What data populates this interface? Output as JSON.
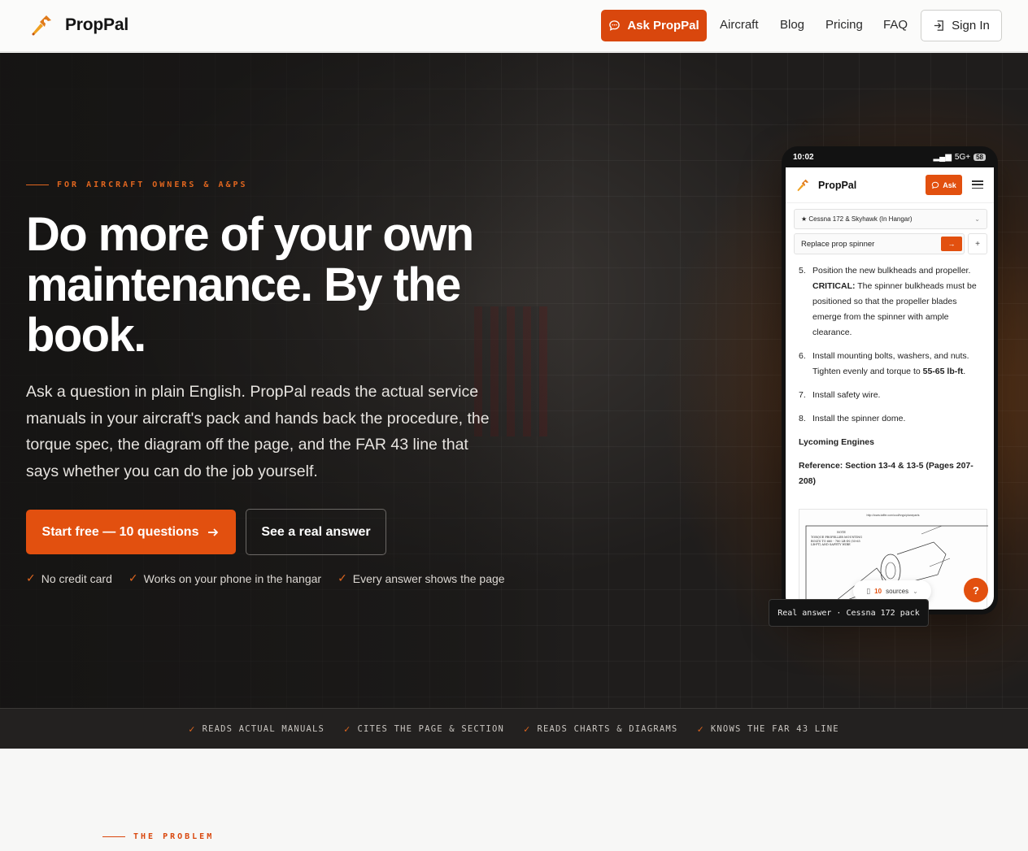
{
  "nav": {
    "brand": "PropPal",
    "ask_label": "Ask PropPal",
    "links": [
      "Aircraft",
      "Blog",
      "Pricing",
      "FAQ"
    ],
    "signin_label": "Sign In"
  },
  "hero": {
    "eyebrow": "FOR AIRCRAFT OWNERS & A&PS",
    "title": "Do more of your own maintenance. By the book.",
    "subtitle": "Ask a question in plain English. PropPal reads the actual service manuals in your aircraft's pack and hands back the procedure, the torque spec, the diagram off the page, and the FAR 43 line that says whether you can do the job yourself.",
    "cta_primary": "Start free — 10 questions",
    "cta_secondary": "See a real answer",
    "checks": [
      "No credit card",
      "Works on your phone in the hangar",
      "Every answer shows the page"
    ]
  },
  "phone": {
    "status_time": "10:02",
    "status_right": "5G+",
    "battery": "58",
    "app_name": "PropPal",
    "ask_label": "Ask",
    "aircraft_select": "★ Cessna 172 & Skyhawk (In Hangar)",
    "question": "Replace prop spinner",
    "steps": [
      {
        "n": "5.",
        "text_pre": "Position the new bulkheads and propeller. ",
        "bold": "CRITICAL:",
        "text_post": " The spinner bulkheads must be positioned so that the propeller blades emerge from the spinner with ample clearance."
      },
      {
        "n": "6.",
        "text_pre": "Install mounting bolts, washers, and nuts. Tighten evenly and torque to ",
        "bold": "55-65 lb-ft",
        "text_post": "."
      },
      {
        "n": "7.",
        "text_pre": "Install safety wire.",
        "bold": "",
        "text_post": ""
      },
      {
        "n": "8.",
        "text_pre": "Install the spinner dome.",
        "bold": "",
        "text_post": ""
      }
    ],
    "section_heading": "Lycoming Engines",
    "reference": "Reference: Section 13-4 & 13-5 (Pages 207-208)",
    "diagram_url": "http://www.taffer.com/cod/hngs/planeparts",
    "diagram_note": "NOTE",
    "diagram_text": "TORQUE PROPELLER MOUNTING BOLTS TO 660 - 780 LB-IN (55-65 LB-FT) AND SAFETY WIRE",
    "sources_count": "10",
    "sources_label": "sources",
    "caption": "Real answer · Cessna 172 pack"
  },
  "strip": [
    "READS ACTUAL MANUALS",
    "CITES THE PAGE & SECTION",
    "READS CHARTS & DIAGRAMS",
    "KNOWS THE FAR 43 LINE"
  ],
  "next_section": {
    "eyebrow": "THE PROBLEM"
  },
  "colors": {
    "accent": "#e2500f",
    "hero_bg": "#191817",
    "strip_bg": "#232120"
  }
}
